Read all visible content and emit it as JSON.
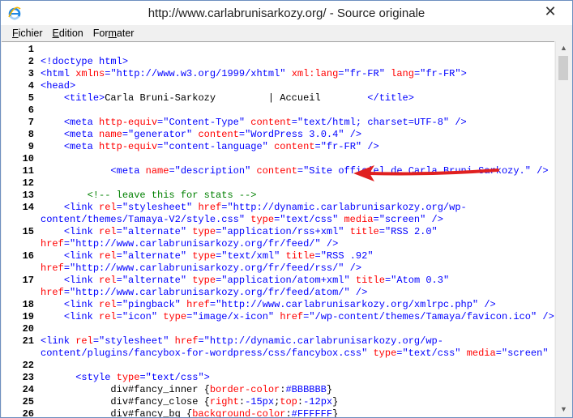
{
  "window": {
    "title": "http://www.carlabrunisarkozy.org/ - Source originale",
    "close_glyph": "✕"
  },
  "menu": [
    {
      "prefix": "",
      "hotkey": "F",
      "rest": "ichier"
    },
    {
      "prefix": "",
      "hotkey": "E",
      "rest": "dition"
    },
    {
      "prefix": "For",
      "hotkey": "m",
      "rest": "ater"
    }
  ],
  "lines": [
    {
      "n": "1",
      "segs": []
    },
    {
      "n": "2",
      "segs": [
        [
          "t",
          "<!doctype html>"
        ]
      ]
    },
    {
      "n": "3",
      "segs": [
        [
          "t",
          "<html "
        ],
        [
          "a",
          "xmlns"
        ],
        [
          "t",
          "="
        ],
        [
          "v",
          "\"http://www.w3.org/1999/xhtml\""
        ],
        [
          "t",
          " "
        ],
        [
          "a",
          "xml:lang"
        ],
        [
          "t",
          "="
        ],
        [
          "v",
          "\"fr-FR\""
        ],
        [
          "t",
          " "
        ],
        [
          "a",
          "lang"
        ],
        [
          "t",
          "="
        ],
        [
          "v",
          "\"fr-FR\""
        ],
        [
          "t",
          ">"
        ]
      ]
    },
    {
      "n": "4",
      "segs": [
        [
          "t",
          "<head>"
        ]
      ]
    },
    {
      "n": "5",
      "segs": [
        [
          "txt",
          "    "
        ],
        [
          "t",
          "<title>"
        ],
        [
          "txt",
          "Carla Bruni-Sarkozy         | Accueil        "
        ],
        [
          "t",
          "</title>"
        ]
      ]
    },
    {
      "n": "6",
      "segs": []
    },
    {
      "n": "7",
      "segs": [
        [
          "txt",
          "    "
        ],
        [
          "t",
          "<meta "
        ],
        [
          "a",
          "http-equiv"
        ],
        [
          "t",
          "="
        ],
        [
          "v",
          "\"Content-Type\""
        ],
        [
          "t",
          " "
        ],
        [
          "a",
          "content"
        ],
        [
          "t",
          "="
        ],
        [
          "v",
          "\"text/html; charset=UTF-8\""
        ],
        [
          "t",
          " />"
        ]
      ]
    },
    {
      "n": "8",
      "segs": [
        [
          "txt",
          "    "
        ],
        [
          "t",
          "<meta "
        ],
        [
          "a",
          "name"
        ],
        [
          "t",
          "="
        ],
        [
          "v",
          "\"generator\""
        ],
        [
          "t",
          " "
        ],
        [
          "a",
          "content"
        ],
        [
          "t",
          "="
        ],
        [
          "v",
          "\"WordPress 3.0.4\""
        ],
        [
          "t",
          " />"
        ]
      ]
    },
    {
      "n": "9",
      "segs": [
        [
          "txt",
          "    "
        ],
        [
          "t",
          "<meta "
        ],
        [
          "a",
          "http-equiv"
        ],
        [
          "t",
          "="
        ],
        [
          "v",
          "\"content-language\""
        ],
        [
          "t",
          " "
        ],
        [
          "a",
          "content"
        ],
        [
          "t",
          "="
        ],
        [
          "v",
          "\"fr-FR\""
        ],
        [
          "t",
          " />"
        ]
      ]
    },
    {
      "n": "10",
      "segs": []
    },
    {
      "n": "11",
      "segs": [
        [
          "txt",
          "            "
        ],
        [
          "t",
          "<meta "
        ],
        [
          "a",
          "name"
        ],
        [
          "t",
          "="
        ],
        [
          "v",
          "\"description\""
        ],
        [
          "t",
          " "
        ],
        [
          "a",
          "content"
        ],
        [
          "t",
          "="
        ],
        [
          "v",
          "\"Site officiel de Carla Bruni-Sarkozy.\""
        ],
        [
          "t",
          " />"
        ]
      ]
    },
    {
      "n": "12",
      "segs": []
    },
    {
      "n": "13",
      "segs": [
        [
          "txt",
          "        "
        ],
        [
          "c",
          "<!-- leave this for stats -->"
        ]
      ]
    },
    {
      "n": "14",
      "segs": [
        [
          "txt",
          "    "
        ],
        [
          "t",
          "<link "
        ],
        [
          "a",
          "rel"
        ],
        [
          "t",
          "="
        ],
        [
          "v",
          "\"stylesheet\""
        ],
        [
          "t",
          " "
        ],
        [
          "a",
          "href"
        ],
        [
          "t",
          "="
        ],
        [
          "v",
          "\"http://dynamic.carlabrunisarkozy.org/wp-"
        ]
      ]
    },
    {
      "n": "",
      "segs": [
        [
          "v",
          "content/themes/Tamaya-V2/style.css\""
        ],
        [
          "t",
          " "
        ],
        [
          "a",
          "type"
        ],
        [
          "t",
          "="
        ],
        [
          "v",
          "\"text/css\""
        ],
        [
          "t",
          " "
        ],
        [
          "a",
          "media"
        ],
        [
          "t",
          "="
        ],
        [
          "v",
          "\"screen\""
        ],
        [
          "t",
          " />"
        ]
      ]
    },
    {
      "n": "15",
      "segs": [
        [
          "txt",
          "    "
        ],
        [
          "t",
          "<link "
        ],
        [
          "a",
          "rel"
        ],
        [
          "t",
          "="
        ],
        [
          "v",
          "\"alternate\""
        ],
        [
          "t",
          " "
        ],
        [
          "a",
          "type"
        ],
        [
          "t",
          "="
        ],
        [
          "v",
          "\"application/rss+xml\""
        ],
        [
          "t",
          " "
        ],
        [
          "a",
          "title"
        ],
        [
          "t",
          "="
        ],
        [
          "v",
          "\"RSS 2.0\""
        ]
      ]
    },
    {
      "n": "",
      "segs": [
        [
          "a",
          "href"
        ],
        [
          "t",
          "="
        ],
        [
          "v",
          "\"http://www.carlabrunisarkozy.org/fr/feed/\""
        ],
        [
          "t",
          " />"
        ]
      ]
    },
    {
      "n": "16",
      "segs": [
        [
          "txt",
          "    "
        ],
        [
          "t",
          "<link "
        ],
        [
          "a",
          "rel"
        ],
        [
          "t",
          "="
        ],
        [
          "v",
          "\"alternate\""
        ],
        [
          "t",
          " "
        ],
        [
          "a",
          "type"
        ],
        [
          "t",
          "="
        ],
        [
          "v",
          "\"text/xml\""
        ],
        [
          "t",
          " "
        ],
        [
          "a",
          "title"
        ],
        [
          "t",
          "="
        ],
        [
          "v",
          "\"RSS .92\""
        ]
      ]
    },
    {
      "n": "",
      "segs": [
        [
          "a",
          "href"
        ],
        [
          "t",
          "="
        ],
        [
          "v",
          "\"http://www.carlabrunisarkozy.org/fr/feed/rss/\""
        ],
        [
          "t",
          " />"
        ]
      ]
    },
    {
      "n": "17",
      "segs": [
        [
          "txt",
          "    "
        ],
        [
          "t",
          "<link "
        ],
        [
          "a",
          "rel"
        ],
        [
          "t",
          "="
        ],
        [
          "v",
          "\"alternate\""
        ],
        [
          "t",
          " "
        ],
        [
          "a",
          "type"
        ],
        [
          "t",
          "="
        ],
        [
          "v",
          "\"application/atom+xml\""
        ],
        [
          "t",
          " "
        ],
        [
          "a",
          "title"
        ],
        [
          "t",
          "="
        ],
        [
          "v",
          "\"Atom 0.3\""
        ]
      ]
    },
    {
      "n": "",
      "segs": [
        [
          "a",
          "href"
        ],
        [
          "t",
          "="
        ],
        [
          "v",
          "\"http://www.carlabrunisarkozy.org/fr/feed/atom/\""
        ],
        [
          "t",
          " />"
        ]
      ]
    },
    {
      "n": "18",
      "segs": [
        [
          "txt",
          "    "
        ],
        [
          "t",
          "<link "
        ],
        [
          "a",
          "rel"
        ],
        [
          "t",
          "="
        ],
        [
          "v",
          "\"pingback\""
        ],
        [
          "t",
          " "
        ],
        [
          "a",
          "href"
        ],
        [
          "t",
          "="
        ],
        [
          "v",
          "\"http://www.carlabrunisarkozy.org/xmlrpc.php\""
        ],
        [
          "t",
          " />"
        ]
      ]
    },
    {
      "n": "19",
      "segs": [
        [
          "txt",
          "    "
        ],
        [
          "t",
          "<link "
        ],
        [
          "a",
          "rel"
        ],
        [
          "t",
          "="
        ],
        [
          "v",
          "\"icon\""
        ],
        [
          "t",
          " "
        ],
        [
          "a",
          "type"
        ],
        [
          "t",
          "="
        ],
        [
          "v",
          "\"image/x-icon\""
        ],
        [
          "t",
          " "
        ],
        [
          "a",
          "href"
        ],
        [
          "t",
          "="
        ],
        [
          "v",
          "\"/wp-content/themes/Tamaya/favicon.ico\""
        ],
        [
          "t",
          " />"
        ]
      ]
    },
    {
      "n": "20",
      "segs": []
    },
    {
      "n": "21",
      "segs": [
        [
          "t",
          "<link "
        ],
        [
          "a",
          "rel"
        ],
        [
          "t",
          "="
        ],
        [
          "v",
          "\"stylesheet\""
        ],
        [
          "t",
          " "
        ],
        [
          "a",
          "href"
        ],
        [
          "t",
          "="
        ],
        [
          "v",
          "\"http://dynamic.carlabrunisarkozy.org/wp-"
        ]
      ]
    },
    {
      "n": "",
      "segs": [
        [
          "v",
          "content/plugins/fancybox-for-wordpress/css/fancybox.css\""
        ],
        [
          "t",
          " "
        ],
        [
          "a",
          "type"
        ],
        [
          "t",
          "="
        ],
        [
          "v",
          "\"text/css\""
        ],
        [
          "t",
          " "
        ],
        [
          "a",
          "media"
        ],
        [
          "t",
          "="
        ],
        [
          "v",
          "\"screen\""
        ],
        [
          "t",
          " />"
        ]
      ]
    },
    {
      "n": "22",
      "segs": []
    },
    {
      "n": "23",
      "segs": [
        [
          "txt",
          "      "
        ],
        [
          "t",
          "<style "
        ],
        [
          "a",
          "type"
        ],
        [
          "t",
          "="
        ],
        [
          "v",
          "\"text/css\""
        ],
        [
          "t",
          ">"
        ]
      ]
    },
    {
      "n": "24",
      "segs": [
        [
          "txt",
          "            div#fancy_inner {"
        ],
        [
          "a",
          "border-color"
        ],
        [
          "txt",
          ":"
        ],
        [
          "v",
          "#BBBBBB"
        ],
        [
          "txt",
          "}"
        ]
      ]
    },
    {
      "n": "25",
      "segs": [
        [
          "txt",
          "            div#fancy_close {"
        ],
        [
          "a",
          "right"
        ],
        [
          "txt",
          ":"
        ],
        [
          "v",
          "-15px"
        ],
        [
          "txt",
          ";"
        ],
        [
          "a",
          "top"
        ],
        [
          "txt",
          ":"
        ],
        [
          "v",
          "-12px"
        ],
        [
          "txt",
          "}"
        ]
      ]
    },
    {
      "n": "26",
      "segs": [
        [
          "txt",
          "            div#fancy_bg {"
        ],
        [
          "a",
          "background-color"
        ],
        [
          "txt",
          ":"
        ],
        [
          "v",
          "#FFFFFF"
        ],
        [
          "txt",
          "}"
        ]
      ]
    }
  ]
}
